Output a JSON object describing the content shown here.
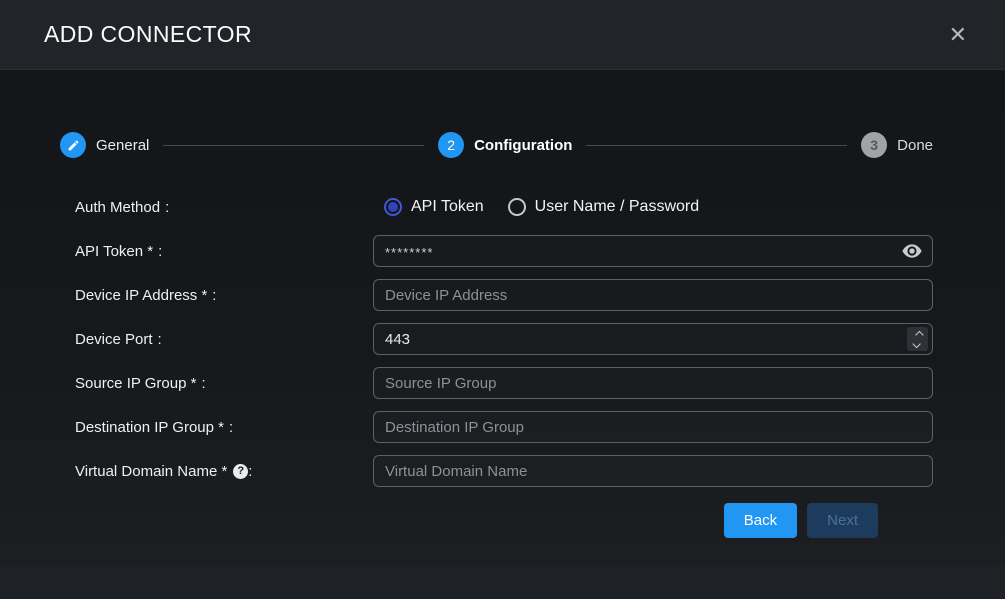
{
  "dialog": {
    "title": "ADD CONNECTOR",
    "close_icon": "✕"
  },
  "steps": {
    "items": [
      {
        "label": "General",
        "indicator": "edit-icon",
        "state": "completed"
      },
      {
        "label": "Configuration",
        "indicator": "2",
        "state": "active"
      },
      {
        "label": "Done",
        "indicator": "3",
        "state": "inactive"
      }
    ]
  },
  "form": {
    "colon": ":",
    "auth": {
      "label": "Auth Method",
      "options": [
        {
          "label": "API Token",
          "selected": true
        },
        {
          "label": "User Name / Password",
          "selected": false
        }
      ]
    },
    "api_token": {
      "label": "API Token *",
      "value": "********"
    },
    "device_ip": {
      "label": "Device IP Address *",
      "placeholder": "Device IP Address"
    },
    "device_port": {
      "label": "Device Port",
      "value": "443"
    },
    "source_ip_group": {
      "label": "Source IP Group *",
      "placeholder": "Source IP Group"
    },
    "dest_ip_group": {
      "label": "Destination IP Group *",
      "placeholder": "Destination IP Group"
    },
    "virtual_domain": {
      "label": "Virtual Domain Name *",
      "help": "?",
      "placeholder": "Virtual Domain Name"
    }
  },
  "footer": {
    "back_label": "Back",
    "next_label": "Next"
  },
  "colors": {
    "accent_blue": "#2196f3",
    "radio_blue": "#3343bb",
    "inactive_step_gray": "#a1a3a7",
    "disabled_button_bg": "#1d3c5d",
    "disabled_button_text": "#4a7097",
    "header_bg": "#212428",
    "content_bg": "#16181c",
    "input_border": "#5d6065"
  }
}
